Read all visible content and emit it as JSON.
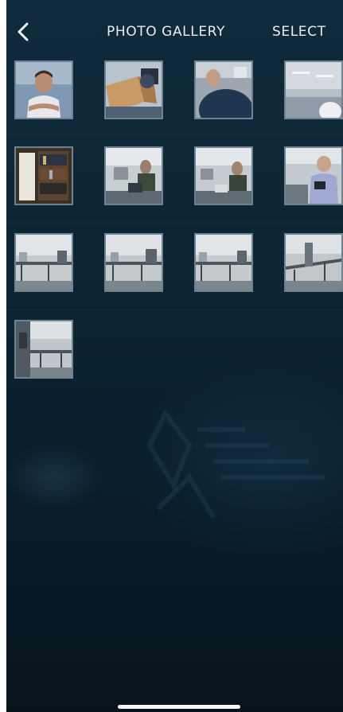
{
  "header": {
    "back_icon": "chevron-left-icon",
    "title": "PHOTO GALLERY",
    "select_label": "SELECT"
  },
  "photos": [
    {
      "row": 1,
      "col": 1,
      "scene": "person-portrait"
    },
    {
      "row": 1,
      "col": 2,
      "scene": "boxes-tilted"
    },
    {
      "row": 1,
      "col": 3,
      "scene": "person-closeup-dark"
    },
    {
      "row": 1,
      "col": 4,
      "scene": "office-ceiling-head"
    },
    {
      "row": 2,
      "col": 1,
      "scene": "bookshelf"
    },
    {
      "row": 2,
      "col": 2,
      "scene": "office-seated-person"
    },
    {
      "row": 2,
      "col": 3,
      "scene": "office-seated-person"
    },
    {
      "row": 2,
      "col": 4,
      "scene": "person-on-phone"
    },
    {
      "row": 3,
      "col": 1,
      "scene": "office-desks"
    },
    {
      "row": 3,
      "col": 2,
      "scene": "office-desks"
    },
    {
      "row": 3,
      "col": 3,
      "scene": "office-desks"
    },
    {
      "row": 3,
      "col": 4,
      "scene": "office-desks"
    },
    {
      "row": 4,
      "col": 1,
      "scene": "office-desks-low"
    }
  ],
  "colors": {
    "background": "#0d2635",
    "text": "#e9eef2",
    "thumb_border": "#6e8290"
  }
}
